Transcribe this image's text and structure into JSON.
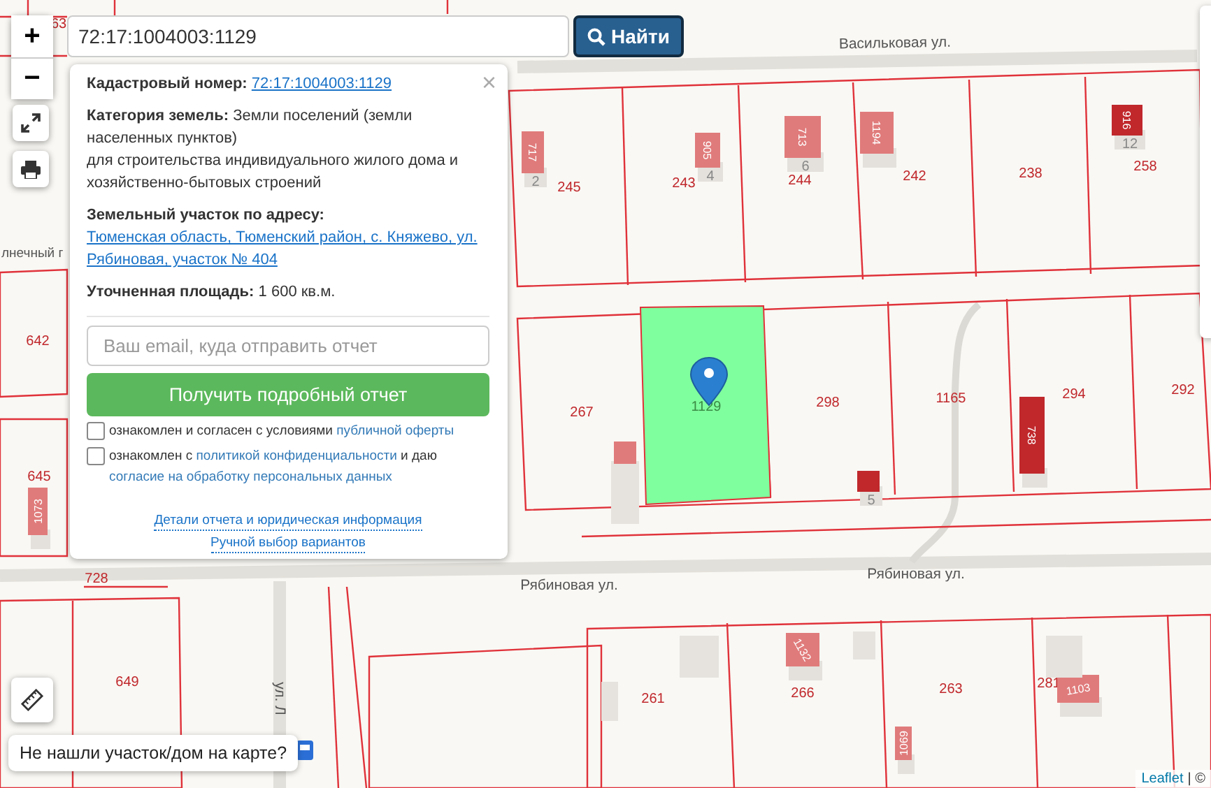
{
  "search": {
    "value": "72:17:1004003:1129",
    "button": "Найти"
  },
  "zoom": {
    "in": "+",
    "out": "−"
  },
  "popup": {
    "close": "×",
    "fields": [
      {
        "label": "Кадастровый номер:",
        "value": "72:17:1004003:1129",
        "kind": "link"
      },
      {
        "label": "Категория земель:",
        "value": "Земли поселений (земли населенных пунктов)\nдля строительства индивидуального жилого дома и хозяйственно-бытовых строений",
        "kind": "text"
      },
      {
        "label": "Земельный участок по адресу:",
        "value": "Тюменская область, Тюменский район, с. Княжево, ул. Рябиновая, участок № 404",
        "kind": "link"
      },
      {
        "label": "Уточненная площадь:",
        "value": "1 600 кв.м.",
        "kind": "text"
      }
    ],
    "email": {
      "placeholder": "Ваш email, куда отправить отчет"
    },
    "submit": "Получить подробный отчет",
    "agreements": [
      {
        "checked": false,
        "parts": [
          {
            "kind": "text",
            "text": "ознакомлен и согласен с условиями "
          },
          {
            "kind": "link",
            "text": "публичной оферты"
          }
        ]
      },
      {
        "checked": false,
        "parts": [
          {
            "kind": "text",
            "text": "ознакомлен с "
          },
          {
            "kind": "link",
            "text": "политикой конфиденциальности"
          },
          {
            "kind": "text",
            "text": " и даю "
          },
          {
            "kind": "link",
            "text": "согласие на обработку персональных данных"
          }
        ]
      }
    ],
    "links": [
      "Детали отчета и юридическая информация",
      "Ручной выбор вариантов"
    ]
  },
  "help": "Не нашли участок/дом на карте?",
  "attribution": {
    "link": "Leaflet",
    "rest": "| ©"
  },
  "map": {
    "streets": [
      "Васильковая ул.",
      "Рябиновая ул.",
      "Рябиновая ул.",
      "лнечный г",
      "ул. Л"
    ],
    "parcels": [
      {
        "label": "245",
        "selected": false
      },
      {
        "label": "243",
        "selected": false
      },
      {
        "label": "244",
        "selected": false
      },
      {
        "label": "242",
        "selected": false
      },
      {
        "label": "238",
        "selected": false
      },
      {
        "label": "258",
        "selected": false
      },
      {
        "label": "267",
        "selected": false
      },
      {
        "label": "1129",
        "selected": true
      },
      {
        "label": "298",
        "selected": false
      },
      {
        "label": "1165",
        "selected": false
      },
      {
        "label": "294",
        "selected": false
      },
      {
        "label": "292",
        "selected": false
      },
      {
        "label": "642",
        "selected": false
      },
      {
        "label": "645",
        "selected": false
      },
      {
        "label": "728",
        "selected": false
      },
      {
        "label": "649",
        "selected": false
      },
      {
        "label": "261",
        "selected": false
      },
      {
        "label": "266",
        "selected": false
      },
      {
        "label": "263",
        "selected": false
      },
      {
        "label": "281",
        "selected": false
      },
      {
        "label": "63",
        "selected": false
      }
    ],
    "buildings": [
      {
        "label": "717",
        "number": "2",
        "color": "#e07b7b"
      },
      {
        "label": "905",
        "number": "4",
        "color": "#e07b7b"
      },
      {
        "label": "713",
        "number": "6",
        "color": "#e07b7b"
      },
      {
        "label": "1194",
        "color": "#e07b7b"
      },
      {
        "label": "916",
        "number": "12",
        "color": "#c0282c"
      },
      {
        "label": "738",
        "color": "#c0282c"
      },
      {
        "label": "1073",
        "color": "#e07b7b"
      },
      {
        "label": "1132",
        "color": "#e07b7b"
      },
      {
        "label": "1069",
        "color": "#e07b7b"
      },
      {
        "label": "1103",
        "color": "#e07b7b"
      },
      {
        "number": "5",
        "color": "#c0282c"
      }
    ]
  }
}
